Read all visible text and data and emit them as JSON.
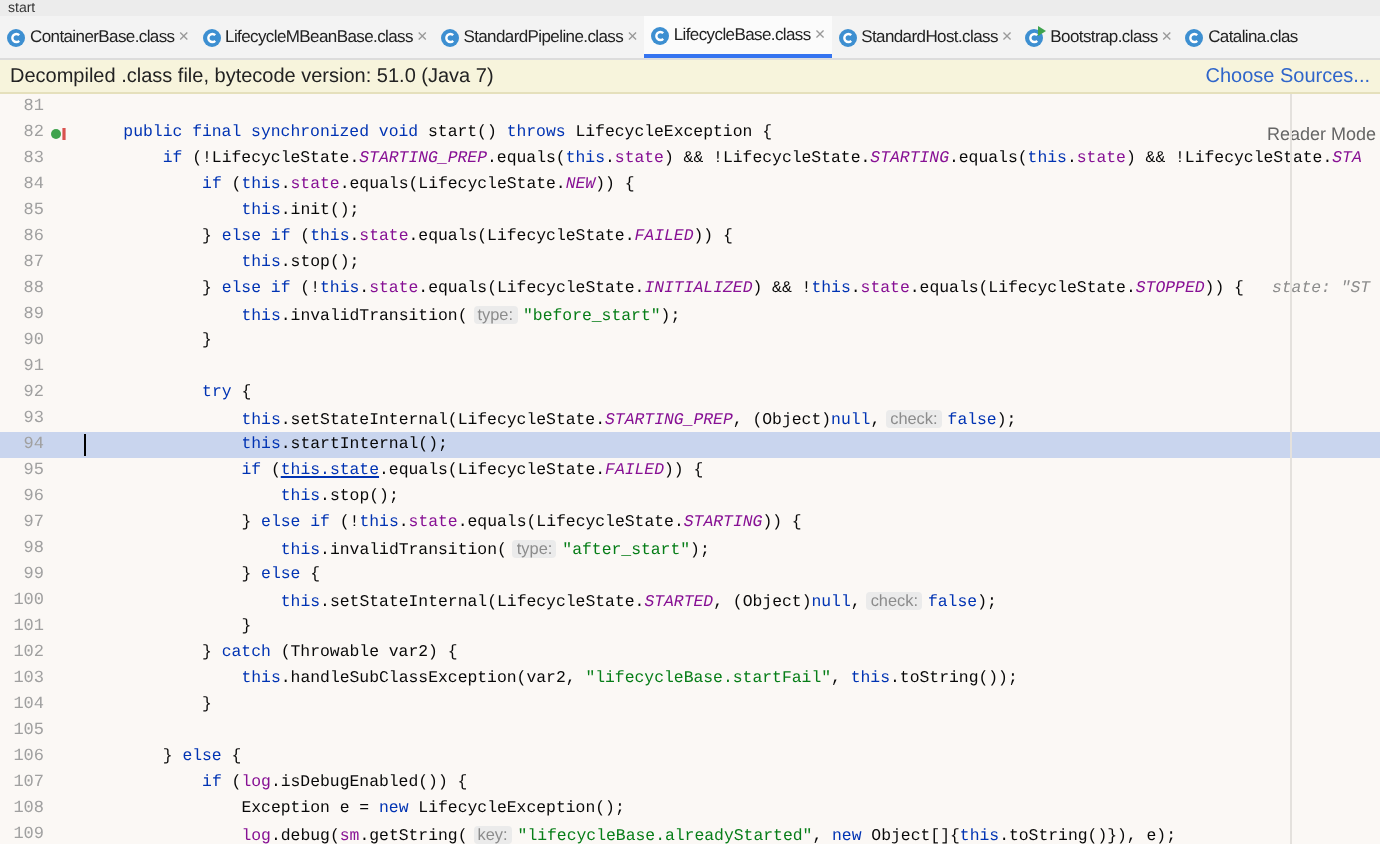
{
  "window": {
    "title": "start"
  },
  "tabs": [
    {
      "label": "ContainerBase.class",
      "close": "×",
      "kind": "class",
      "selected": false
    },
    {
      "label": "LifecycleMBeanBase.class",
      "close": "×",
      "kind": "class",
      "selected": false
    },
    {
      "label": "StandardPipeline.class",
      "close": "×",
      "kind": "class",
      "selected": false
    },
    {
      "label": "LifecycleBase.class",
      "close": "×",
      "kind": "class",
      "selected": true
    },
    {
      "label": "StandardHost.class",
      "close": "×",
      "kind": "class",
      "selected": false
    },
    {
      "label": "Bootstrap.class",
      "close": "×",
      "kind": "runnable",
      "selected": false
    },
    {
      "label": "Catalina.clas",
      "kind": "class",
      "selected": false
    }
  ],
  "banner": {
    "text": "Decompiled .class file, bytecode version: 51.0 (Java 7)",
    "link": "Choose Sources..."
  },
  "reader_mode": "Reader Mode",
  "lines": [
    {
      "number": "81",
      "current": false,
      "marker": false
    },
    {
      "number": "82",
      "current": false,
      "marker": true,
      "tokens": [
        {
          "kind": "kw",
          "text": "public final synchronized void"
        },
        {
          "kind": "plain",
          "text": " start() "
        },
        {
          "kind": "kw",
          "text": "throws"
        },
        {
          "kind": "plain",
          "text": " LifecycleException {"
        }
      ],
      "children": [
        {
          "number": "83",
          "current": false,
          "marker": false,
          "tokens": [
            {
              "kind": "kw",
              "text": "if"
            },
            {
              "kind": "plain",
              "text": " (!LifecycleState."
            },
            {
              "kind": "const",
              "text": "STARTING_PREP"
            },
            {
              "kind": "plain",
              "text": ".equals("
            },
            {
              "kind": "kw",
              "text": "this"
            },
            {
              "kind": "plain",
              "text": "."
            },
            {
              "kind": "field",
              "text": "state"
            },
            {
              "kind": "plain",
              "text": ") && !LifecycleState."
            },
            {
              "kind": "const",
              "text": "STARTING"
            },
            {
              "kind": "plain",
              "text": ".equals("
            },
            {
              "kind": "kw",
              "text": "this"
            },
            {
              "kind": "plain",
              "text": "."
            },
            {
              "kind": "field",
              "text": "state"
            },
            {
              "kind": "plain",
              "text": ") && !LifecycleState."
            },
            {
              "kind": "const",
              "text": "STA"
            }
          ],
          "children": [
            {
              "number": "84",
              "current": false,
              "marker": false,
              "tokens": [
                {
                  "kind": "kw",
                  "text": "if"
                },
                {
                  "kind": "plain",
                  "text": " ("
                },
                {
                  "kind": "kw",
                  "text": "this"
                },
                {
                  "kind": "plain",
                  "text": "."
                },
                {
                  "kind": "field",
                  "text": "state"
                },
                {
                  "kind": "plain",
                  "text": ".equals(LifecycleState."
                },
                {
                  "kind": "const",
                  "text": "NEW"
                },
                {
                  "kind": "plain",
                  "text": ")) {"
                }
              ],
              "children": [
                {
                  "number": "85",
                  "current": false,
                  "marker": false,
                  "tokens": [
                    {
                      "kind": "kw",
                      "text": "this"
                    },
                    {
                      "kind": "plain",
                      "text": ".init();"
                    }
                  ]
                }
              ]
            },
            {
              "number": "86",
              "current": false,
              "marker": false,
              "tokens": [
                {
                  "kind": "plain",
                  "text": "} "
                },
                {
                  "kind": "kw",
                  "text": "else if"
                },
                {
                  "kind": "plain",
                  "text": " ("
                },
                {
                  "kind": "kw",
                  "text": "this"
                },
                {
                  "kind": "plain",
                  "text": "."
                },
                {
                  "kind": "field",
                  "text": "state"
                },
                {
                  "kind": "plain",
                  "text": ".equals(LifecycleState."
                },
                {
                  "kind": "const",
                  "text": "FAILED"
                },
                {
                  "kind": "plain",
                  "text": ")) {"
                }
              ],
              "children": [
                {
                  "number": "87",
                  "current": false,
                  "marker": false,
                  "tokens": [
                    {
                      "kind": "kw",
                      "text": "this"
                    },
                    {
                      "kind": "plain",
                      "text": ".stop();"
                    }
                  ]
                }
              ]
            },
            {
              "number": "88",
              "current": false,
              "marker": false,
              "tokens": [
                {
                  "kind": "plain",
                  "text": "} "
                },
                {
                  "kind": "kw",
                  "text": "else if"
                },
                {
                  "kind": "plain",
                  "text": " (!"
                },
                {
                  "kind": "kw",
                  "text": "this"
                },
                {
                  "kind": "plain",
                  "text": "."
                },
                {
                  "kind": "field",
                  "text": "state"
                },
                {
                  "kind": "plain",
                  "text": ".equals(LifecycleState."
                },
                {
                  "kind": "const",
                  "text": "INITIALIZED"
                },
                {
                  "kind": "plain",
                  "text": ") && !"
                },
                {
                  "kind": "kw",
                  "text": "this"
                },
                {
                  "kind": "plain",
                  "text": "."
                },
                {
                  "kind": "field",
                  "text": "state"
                },
                {
                  "kind": "plain",
                  "text": ".equals(LifecycleState."
                },
                {
                  "kind": "const",
                  "text": "STOPPED"
                },
                {
                  "kind": "plain",
                  "text": ")) {"
                },
                {
                  "kind": "debug",
                  "text": "state: \"ST"
                }
              ],
              "children": [
                {
                  "number": "89",
                  "current": false,
                  "marker": false,
                  "tokens": [
                    {
                      "kind": "kw",
                      "text": "this"
                    },
                    {
                      "kind": "plain",
                      "text": ".invalidTransition("
                    },
                    {
                      "kind": "hint",
                      "text": "type:"
                    },
                    {
                      "kind": "str",
                      "text": "\"before_start\""
                    },
                    {
                      "kind": "plain",
                      "text": ");"
                    }
                  ]
                }
              ]
            },
            {
              "number": "90",
              "current": false,
              "marker": false,
              "tokens": [
                {
                  "kind": "plain",
                  "text": "}"
                }
              ]
            },
            {
              "number": "91",
              "current": false,
              "marker": false
            },
            {
              "number": "92",
              "current": false,
              "marker": false,
              "tokens": [
                {
                  "kind": "kw",
                  "text": "try"
                },
                {
                  "kind": "plain",
                  "text": " {"
                }
              ],
              "children": [
                {
                  "number": "93",
                  "current": false,
                  "marker": false,
                  "tokens": [
                    {
                      "kind": "kw",
                      "text": "this"
                    },
                    {
                      "kind": "plain",
                      "text": ".setStateInternal(LifecycleState."
                    },
                    {
                      "kind": "const",
                      "text": "STARTING_PREP"
                    },
                    {
                      "kind": "plain",
                      "text": ", (Object)"
                    },
                    {
                      "kind": "kw",
                      "text": "null"
                    },
                    {
                      "kind": "plain",
                      "text": ","
                    },
                    {
                      "kind": "hint",
                      "text": "check:"
                    },
                    {
                      "kind": "kw",
                      "text": "false"
                    },
                    {
                      "kind": "plain",
                      "text": ");"
                    }
                  ]
                },
                {
                  "number": "94",
                  "current": true,
                  "marker": false,
                  "tokens": [
                    {
                      "kind": "kw",
                      "text": "this"
                    },
                    {
                      "kind": "plain",
                      "text": ".startInternal();"
                    }
                  ]
                },
                {
                  "number": "95",
                  "current": false,
                  "marker": false,
                  "tokens": [
                    {
                      "kind": "kw",
                      "text": "if"
                    },
                    {
                      "kind": "plain",
                      "text": " ("
                    },
                    {
                      "kind": "link",
                      "text": "this.state"
                    },
                    {
                      "kind": "plain",
                      "text": ".equals(LifecycleState."
                    },
                    {
                      "kind": "const",
                      "text": "FAILED"
                    },
                    {
                      "kind": "plain",
                      "text": ")) {"
                    }
                  ],
                  "children": [
                    {
                      "number": "96",
                      "current": false,
                      "marker": false,
                      "tokens": [
                        {
                          "kind": "kw",
                          "text": "this"
                        },
                        {
                          "kind": "plain",
                          "text": ".stop();"
                        }
                      ]
                    }
                  ]
                },
                {
                  "number": "97",
                  "current": false,
                  "marker": false,
                  "tokens": [
                    {
                      "kind": "plain",
                      "text": "} "
                    },
                    {
                      "kind": "kw",
                      "text": "else if"
                    },
                    {
                      "kind": "plain",
                      "text": " (!"
                    },
                    {
                      "kind": "kw",
                      "text": "this"
                    },
                    {
                      "kind": "plain",
                      "text": "."
                    },
                    {
                      "kind": "field",
                      "text": "state"
                    },
                    {
                      "kind": "plain",
                      "text": ".equals(LifecycleState."
                    },
                    {
                      "kind": "const",
                      "text": "STARTING"
                    },
                    {
                      "kind": "plain",
                      "text": ")) {"
                    }
                  ],
                  "children": [
                    {
                      "number": "98",
                      "current": false,
                      "marker": false,
                      "tokens": [
                        {
                          "kind": "kw",
                          "text": "this"
                        },
                        {
                          "kind": "plain",
                          "text": ".invalidTransition("
                        },
                        {
                          "kind": "hint",
                          "text": "type:"
                        },
                        {
                          "kind": "str",
                          "text": "\"after_start\""
                        },
                        {
                          "kind": "plain",
                          "text": ");"
                        }
                      ]
                    }
                  ]
                },
                {
                  "number": "99",
                  "current": false,
                  "marker": false,
                  "tokens": [
                    {
                      "kind": "plain",
                      "text": "} "
                    },
                    {
                      "kind": "kw",
                      "text": "else"
                    },
                    {
                      "kind": "plain",
                      "text": " {"
                    }
                  ],
                  "children": [
                    {
                      "number": "100",
                      "current": false,
                      "marker": false,
                      "tokens": [
                        {
                          "kind": "kw",
                          "text": "this"
                        },
                        {
                          "kind": "plain",
                          "text": ".setStateInternal(LifecycleState."
                        },
                        {
                          "kind": "const",
                          "text": "STARTED"
                        },
                        {
                          "kind": "plain",
                          "text": ", (Object)"
                        },
                        {
                          "kind": "kw",
                          "text": "null"
                        },
                        {
                          "kind": "plain",
                          "text": ","
                        },
                        {
                          "kind": "hint",
                          "text": "check:"
                        },
                        {
                          "kind": "kw",
                          "text": "false"
                        },
                        {
                          "kind": "plain",
                          "text": ");"
                        }
                      ]
                    }
                  ]
                },
                {
                  "number": "101",
                  "current": false,
                  "marker": false,
                  "tokens": [
                    {
                      "kind": "plain",
                      "text": "}"
                    }
                  ]
                }
              ]
            },
            {
              "number": "102",
              "current": false,
              "marker": false,
              "tokens": [
                {
                  "kind": "plain",
                  "text": "} "
                },
                {
                  "kind": "kw",
                  "text": "catch"
                },
                {
                  "kind": "plain",
                  "text": " (Throwable var2) {"
                }
              ],
              "children": [
                {
                  "number": "103",
                  "current": false,
                  "marker": false,
                  "tokens": [
                    {
                      "kind": "kw",
                      "text": "this"
                    },
                    {
                      "kind": "plain",
                      "text": ".handleSubClassException(var2, "
                    },
                    {
                      "kind": "str",
                      "text": "\"lifecycleBase.startFail\""
                    },
                    {
                      "kind": "plain",
                      "text": ", "
                    },
                    {
                      "kind": "kw",
                      "text": "this"
                    },
                    {
                      "kind": "plain",
                      "text": ".toString());"
                    }
                  ]
                }
              ]
            },
            {
              "number": "104",
              "current": false,
              "marker": false,
              "tokens": [
                {
                  "kind": "plain",
                  "text": "}"
                }
              ]
            },
            {
              "number": "105",
              "current": false,
              "marker": false
            }
          ]
        },
        {
          "number": "106",
          "current": false,
          "marker": false,
          "tokens": [
            {
              "kind": "plain",
              "text": "} "
            },
            {
              "kind": "kw",
              "text": "else"
            },
            {
              "kind": "plain",
              "text": " {"
            }
          ],
          "children": [
            {
              "number": "107",
              "current": false,
              "marker": false,
              "tokens": [
                {
                  "kind": "kw",
                  "text": "if"
                },
                {
                  "kind": "plain",
                  "text": " ("
                },
                {
                  "kind": "field",
                  "text": "log"
                },
                {
                  "kind": "plain",
                  "text": ".isDebugEnabled()) {"
                }
              ],
              "children": [
                {
                  "number": "108",
                  "current": false,
                  "marker": false,
                  "tokens": [
                    {
                      "kind": "plain",
                      "text": "Exception e = "
                    },
                    {
                      "kind": "kw",
                      "text": "new"
                    },
                    {
                      "kind": "plain",
                      "text": " LifecycleException();"
                    }
                  ]
                },
                {
                  "number": "109",
                  "current": false,
                  "marker": false,
                  "tokens": [
                    {
                      "kind": "field",
                      "text": "log"
                    },
                    {
                      "kind": "plain",
                      "text": ".debug("
                    },
                    {
                      "kind": "field",
                      "text": "sm"
                    },
                    {
                      "kind": "plain",
                      "text": ".getString("
                    },
                    {
                      "kind": "hint",
                      "text": "key:"
                    },
                    {
                      "kind": "str",
                      "text": "\"lifecycleBase.alreadyStarted\""
                    },
                    {
                      "kind": "plain",
                      "text": ", "
                    },
                    {
                      "kind": "kw",
                      "text": "new"
                    },
                    {
                      "kind": "plain",
                      "text": " Object[]{"
                    },
                    {
                      "kind": "kw",
                      "text": "this"
                    },
                    {
                      "kind": "plain",
                      "text": ".toString()}), e);"
                    }
                  ]
                }
              ]
            }
          ]
        }
      ]
    }
  ]
}
